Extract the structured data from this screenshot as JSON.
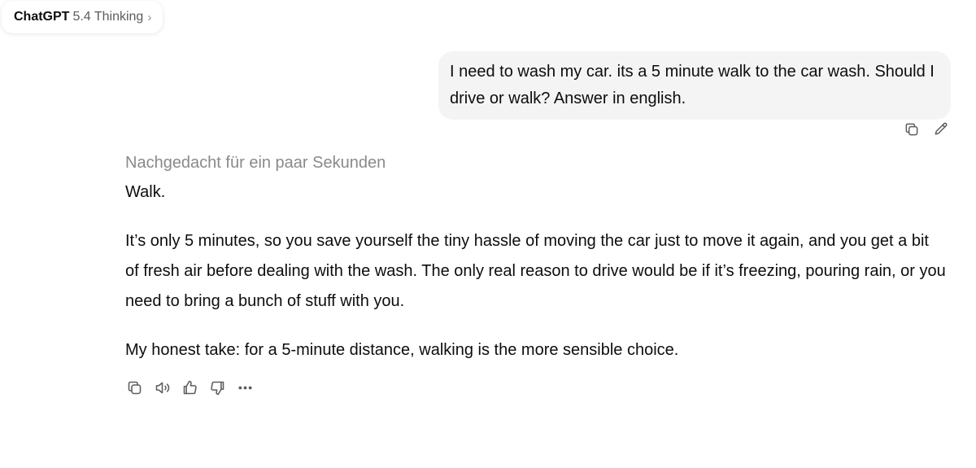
{
  "header": {
    "model_name": "ChatGPT",
    "model_version": "5.4 Thinking",
    "chevron": "›"
  },
  "user_message": {
    "text": "I need to wash my car. its a 5 minute walk to the car wash. Should I drive or walk? Answer in english.",
    "actions": [
      {
        "icon": "copy-icon"
      },
      {
        "icon": "edit-pencil-icon"
      }
    ]
  },
  "assistant_message": {
    "thought_label": "Nachgedacht für ein paar Sekunden",
    "paragraphs": [
      "Walk.",
      "It’s only 5 minutes, so you save yourself the tiny hassle of moving the car just to move it again, and you get a bit of fresh air before dealing with the wash. The only real reason to drive would be if it’s freezing, pouring rain, or you need to bring a bunch of stuff with you.",
      "My honest take: for a 5-minute distance, walking is the more sensible choice."
    ],
    "actions": [
      {
        "icon": "copy-icon"
      },
      {
        "icon": "read-aloud-icon"
      },
      {
        "icon": "thumbs-up-icon"
      },
      {
        "icon": "thumbs-down-icon"
      },
      {
        "icon": "more-options-icon"
      }
    ]
  },
  "colors": {
    "bubble_bg": "#f4f4f4",
    "text": "#0d0d0d",
    "muted_text": "#8a8a8a",
    "icon": "#5d5d5d"
  }
}
